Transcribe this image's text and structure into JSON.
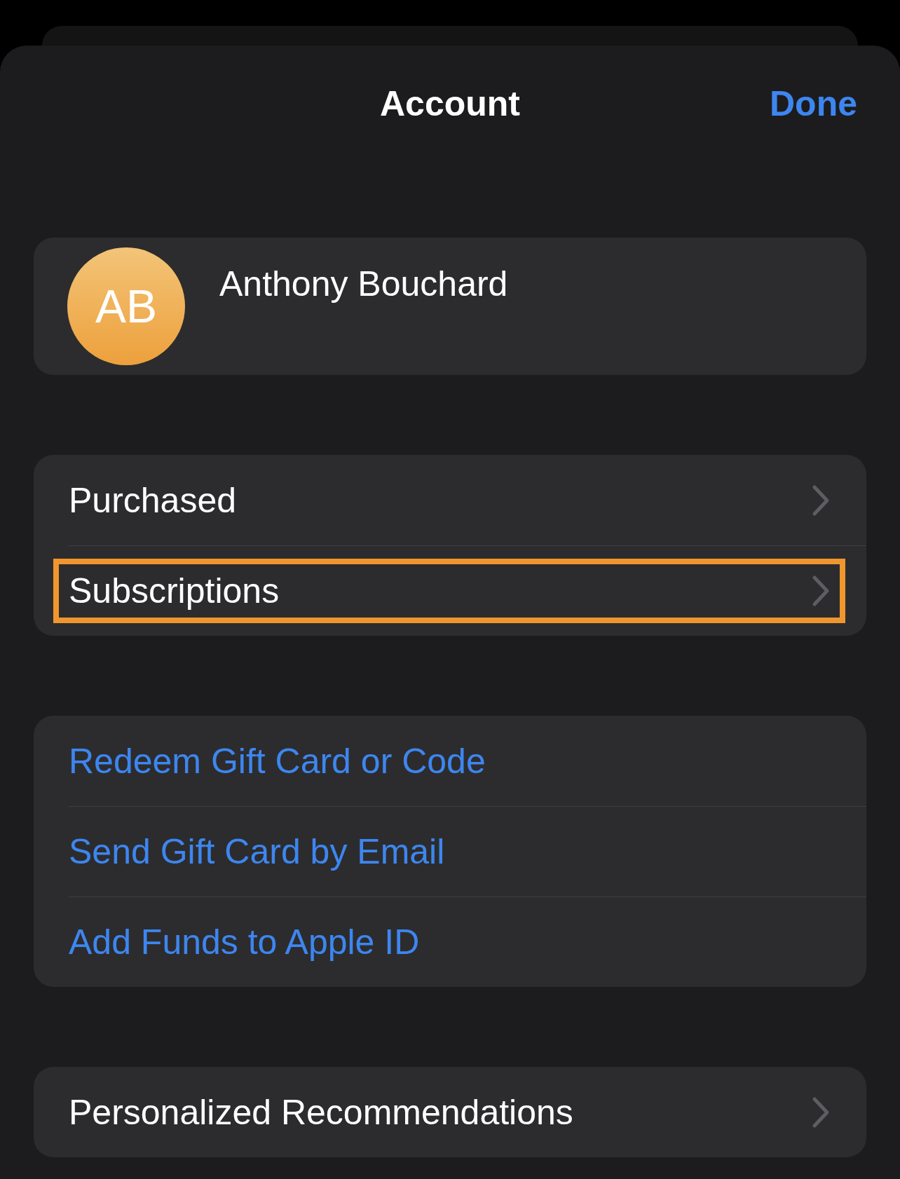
{
  "nav": {
    "title": "Account",
    "done_button": "Done"
  },
  "profile": {
    "initials": "AB",
    "name": "Anthony Bouchard"
  },
  "groups": [
    {
      "rows": [
        {
          "label": "Purchased",
          "kind": "disclosure",
          "highlighted": false
        },
        {
          "label": "Subscriptions",
          "kind": "disclosure",
          "highlighted": true
        }
      ]
    },
    {
      "rows": [
        {
          "label": "Redeem Gift Card or Code",
          "kind": "action",
          "highlighted": false
        },
        {
          "label": "Send Gift Card by Email",
          "kind": "action",
          "highlighted": false
        },
        {
          "label": "Add Funds to Apple ID",
          "kind": "action",
          "highlighted": false
        }
      ]
    },
    {
      "rows": [
        {
          "label": "Personalized Recommendations",
          "kind": "disclosure",
          "highlighted": false
        }
      ]
    }
  ]
}
